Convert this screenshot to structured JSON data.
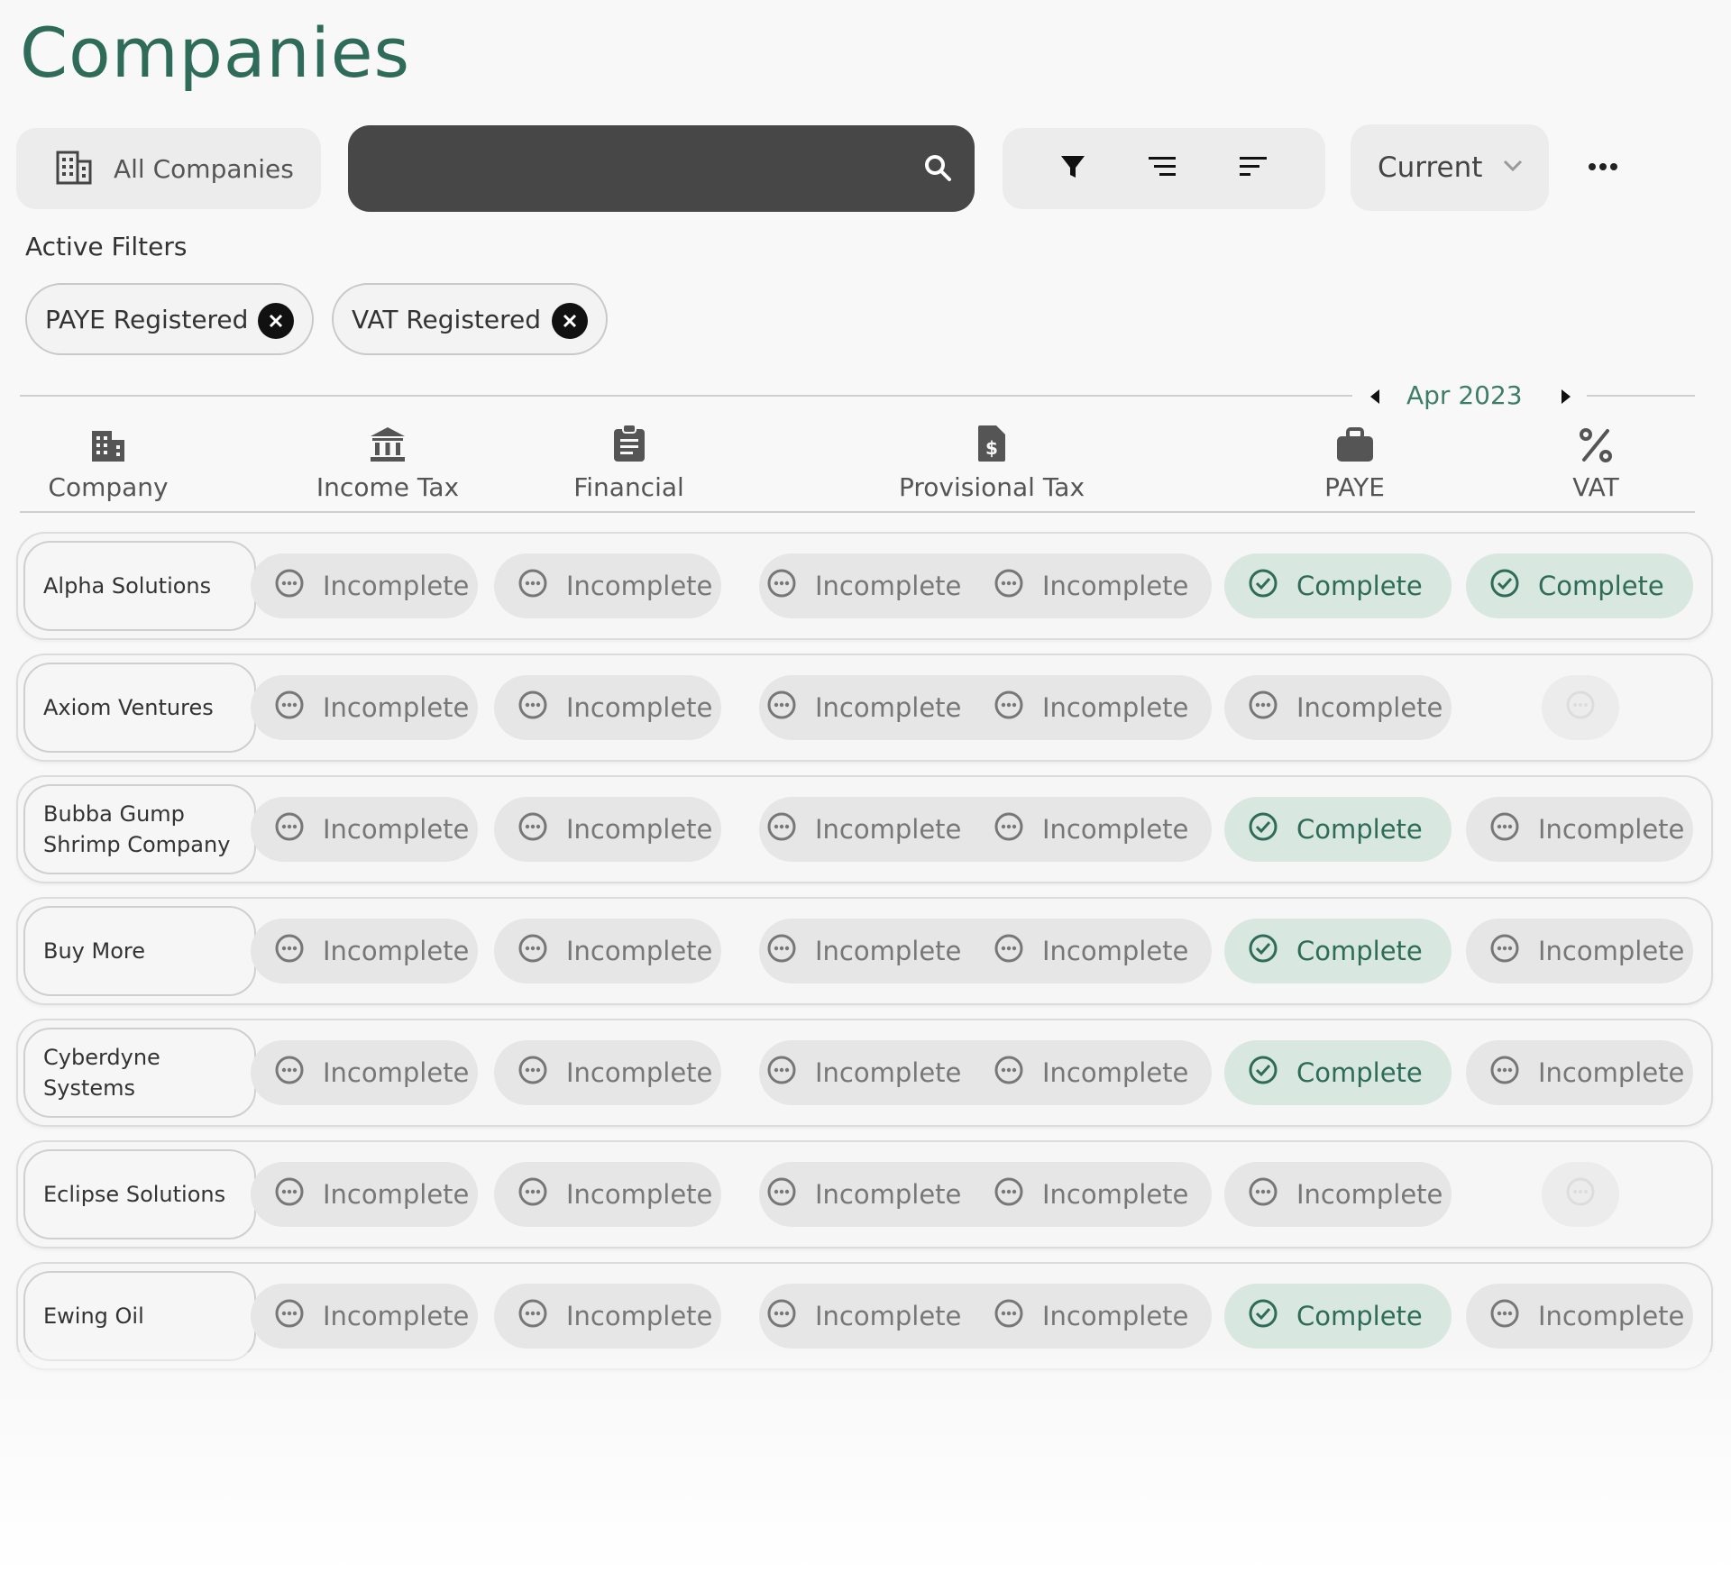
{
  "page": {
    "title": "Companies"
  },
  "toolbar": {
    "all_companies_label": "All Companies",
    "search_value": "",
    "period_select": "Current"
  },
  "filters": {
    "heading": "Active Filters",
    "chips": [
      "PAYE Registered",
      "VAT Registered"
    ]
  },
  "period": {
    "label": "Apr 2023"
  },
  "columns": {
    "company": "Company",
    "income_tax": "Income Tax",
    "financial": "Financial",
    "provisional_tax": "Provisional Tax",
    "paye": "PAYE",
    "vat": "VAT"
  },
  "status_labels": {
    "incomplete": "Incomplete",
    "complete": "Complete"
  },
  "rows": [
    {
      "company": "Alpha Solutions",
      "income_tax": "Incomplete",
      "financial": "Incomplete",
      "provisional_1": "Incomplete",
      "provisional_2": "Incomplete",
      "paye": "Complete",
      "vat": "Complete"
    },
    {
      "company": "Axiom Ventures",
      "income_tax": "Incomplete",
      "financial": "Incomplete",
      "provisional_1": "Incomplete",
      "provisional_2": "Incomplete",
      "paye": "Incomplete",
      "vat": ""
    },
    {
      "company": "Bubba Gump Shrimp Company",
      "income_tax": "Incomplete",
      "financial": "Incomplete",
      "provisional_1": "Incomplete",
      "provisional_2": "Incomplete",
      "paye": "Complete",
      "vat": "Incomplete"
    },
    {
      "company": "Buy More",
      "income_tax": "Incomplete",
      "financial": "Incomplete",
      "provisional_1": "Incomplete",
      "provisional_2": "Incomplete",
      "paye": "Complete",
      "vat": "Incomplete"
    },
    {
      "company": "Cyberdyne Systems",
      "income_tax": "Incomplete",
      "financial": "Incomplete",
      "provisional_1": "Incomplete",
      "provisional_2": "Incomplete",
      "paye": "Complete",
      "vat": "Incomplete"
    },
    {
      "company": "Eclipse Solutions",
      "income_tax": "Incomplete",
      "financial": "Incomplete",
      "provisional_1": "Incomplete",
      "provisional_2": "Incomplete",
      "paye": "Incomplete",
      "vat": ""
    },
    {
      "company": "Ewing Oil",
      "income_tax": "Incomplete",
      "financial": "Incomplete",
      "provisional_1": "Incomplete",
      "provisional_2": "Incomplete",
      "paye": "Complete",
      "vat": "Incomplete"
    }
  ],
  "colors": {
    "accent": "#2e6b58",
    "complete_bg": "#d8e8e0",
    "incomplete_bg": "#e6e6e6",
    "search_bg": "#474747"
  }
}
